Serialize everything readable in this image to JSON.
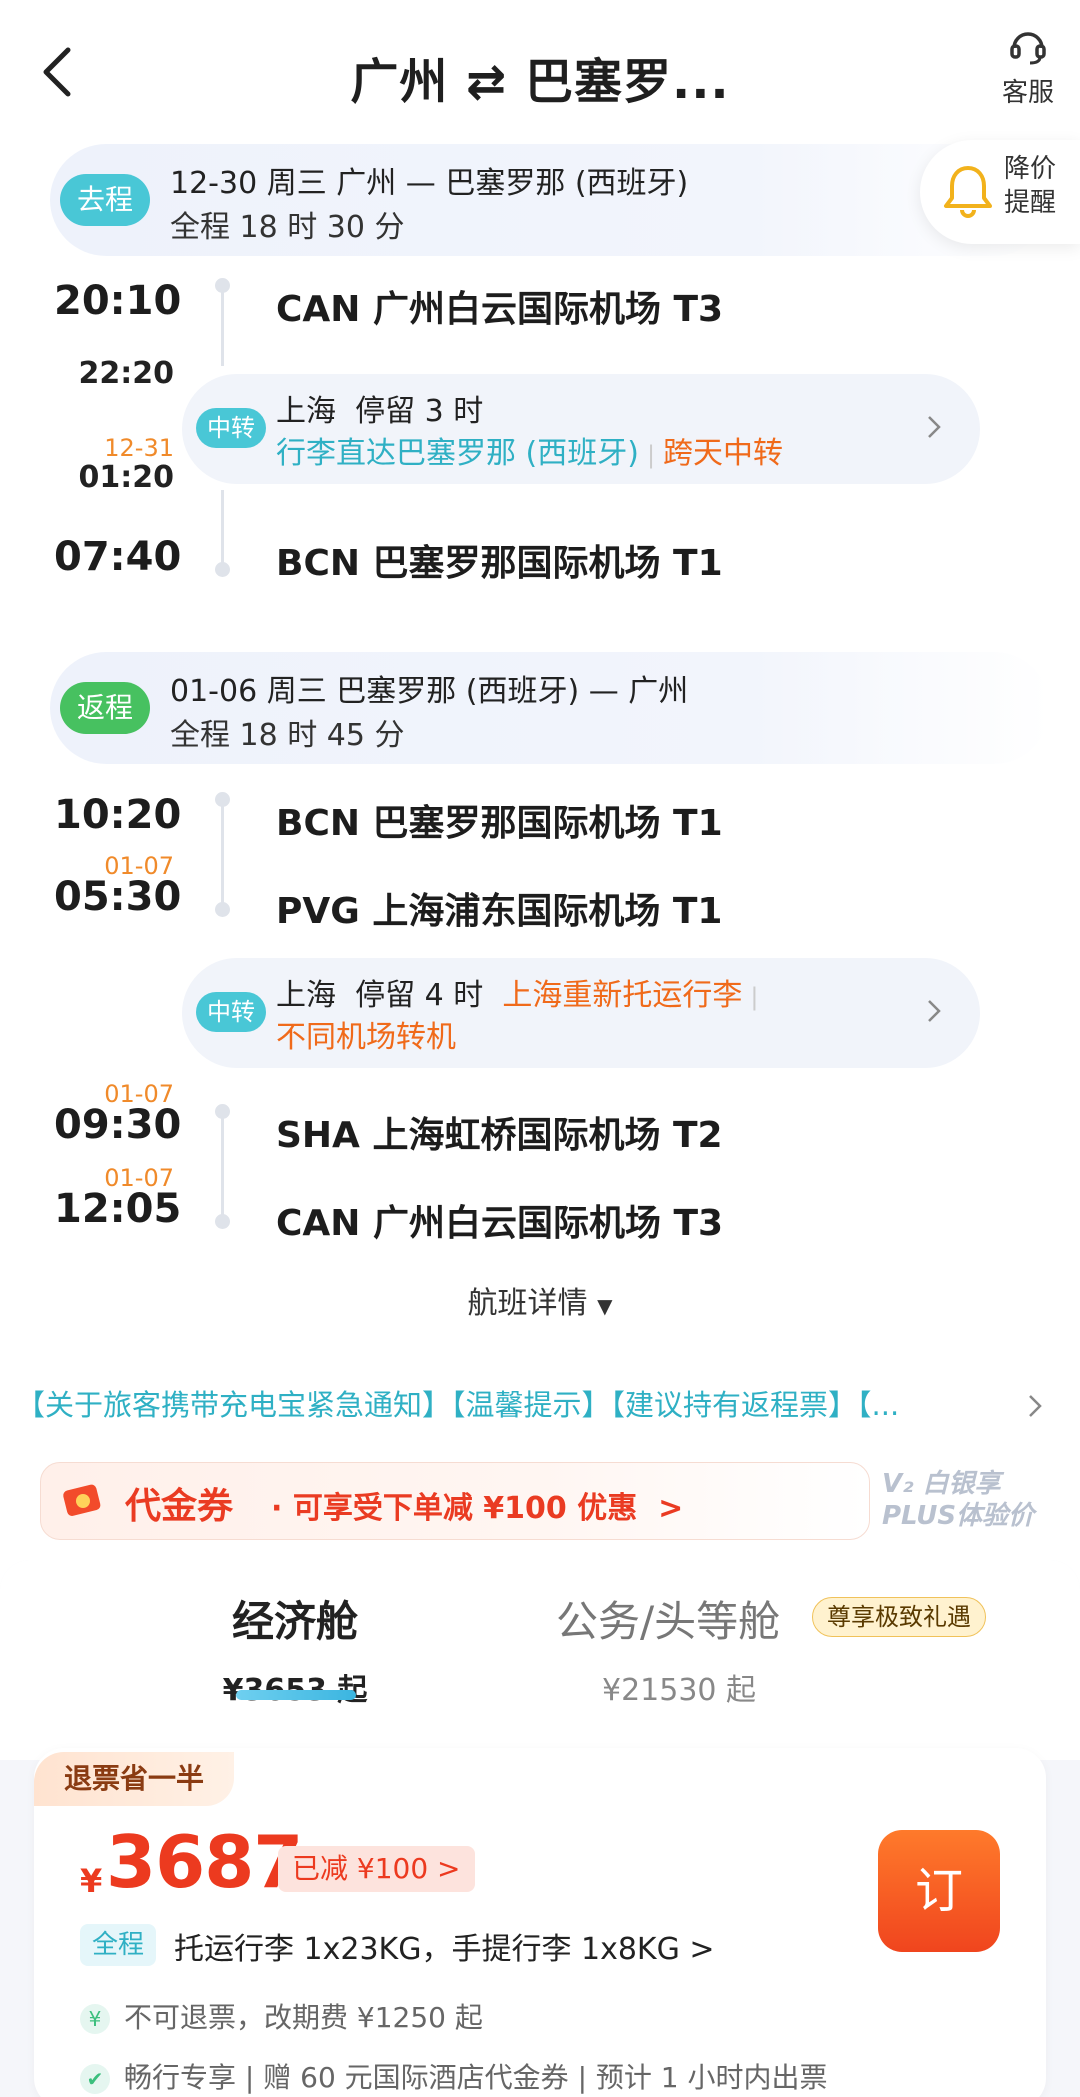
{
  "header": {
    "title": "广州 ⇄ 巴塞罗...",
    "service_label": "客服"
  },
  "price_alert": {
    "label_line1": "降价",
    "label_line2": "提醒"
  },
  "outbound": {
    "tag": "去程",
    "date_route": "12-30 周三   广州 — 巴塞罗那 (西班牙)",
    "duration": "全程 18 时 30 分",
    "dep_time": "20:10",
    "dep_airport": "CAN 广州白云国际机场 T3",
    "transfer_arrive_time": "22:20",
    "transfer_depart_date": "12-31",
    "transfer_depart_time": "01:20",
    "transfer_tag": "中转",
    "transfer_city": "上海",
    "transfer_stay": "停留 3 时",
    "transfer_note1": "行李直达巴塞罗那 (西班牙)",
    "transfer_note2": "跨天中转",
    "arr_time": "07:40",
    "arr_airport": "BCN 巴塞罗那国际机场 T1"
  },
  "return": {
    "tag": "返程",
    "date_route": "01-06 周三   巴塞罗那 (西班牙) — 广州",
    "duration": "全程 18 时 45 分",
    "dep_time": "10:20",
    "dep_airport": "BCN 巴塞罗那国际机场 T1",
    "arr1_date": "01-07",
    "arr1_time": "05:30",
    "arr1_airport": "PVG 上海浦东国际机场 T1",
    "transfer_tag": "中转",
    "transfer_city": "上海",
    "transfer_stay": "停留 4 时",
    "transfer_note1": "上海重新托运行李",
    "transfer_note2": "不同机场转机",
    "dep2_date": "01-07",
    "dep2_time": "09:30",
    "dep2_airport": "SHA 上海虹桥国际机场 T2",
    "arr2_date": "01-07",
    "arr2_time": "12:05",
    "arr2_airport": "CAN 广州白云国际机场 T3"
  },
  "flight_detail_label": "航班详情",
  "notice_text": "【关于旅客携带充电宝紧急通知】【温馨提示】【建议持有返程票】【...",
  "voucher": {
    "title": "代金券",
    "desc": "· 可享受下单减 ¥100 优惠",
    "plus_line1": "V₂ 白银享",
    "plus_line2": "PLUS体验价"
  },
  "cabins": [
    {
      "name": "经济舱",
      "price": "¥3653 起"
    },
    {
      "name": "公务/头等舱",
      "price": "¥21530 起",
      "badge": "尊享极致礼遇"
    }
  ],
  "offer": {
    "ribbon": "退票省一半",
    "currency": "¥",
    "price": "3687",
    "discount": "已减  ¥100 >",
    "book_label": "订",
    "scope_tag": "全程",
    "luggage": "托运行李 1x23KG，手提行李 1x8KG >",
    "refund": "不可退票，改期费 ¥1250 起",
    "perks": "畅行专享 | 赠 60 元国际酒店代金券 | 预计 1 小时内出票"
  },
  "colors": {
    "accent_blue": "#2fb0c4",
    "accent_orange": "#f06a1a",
    "price_red": "#ec3a1f"
  }
}
